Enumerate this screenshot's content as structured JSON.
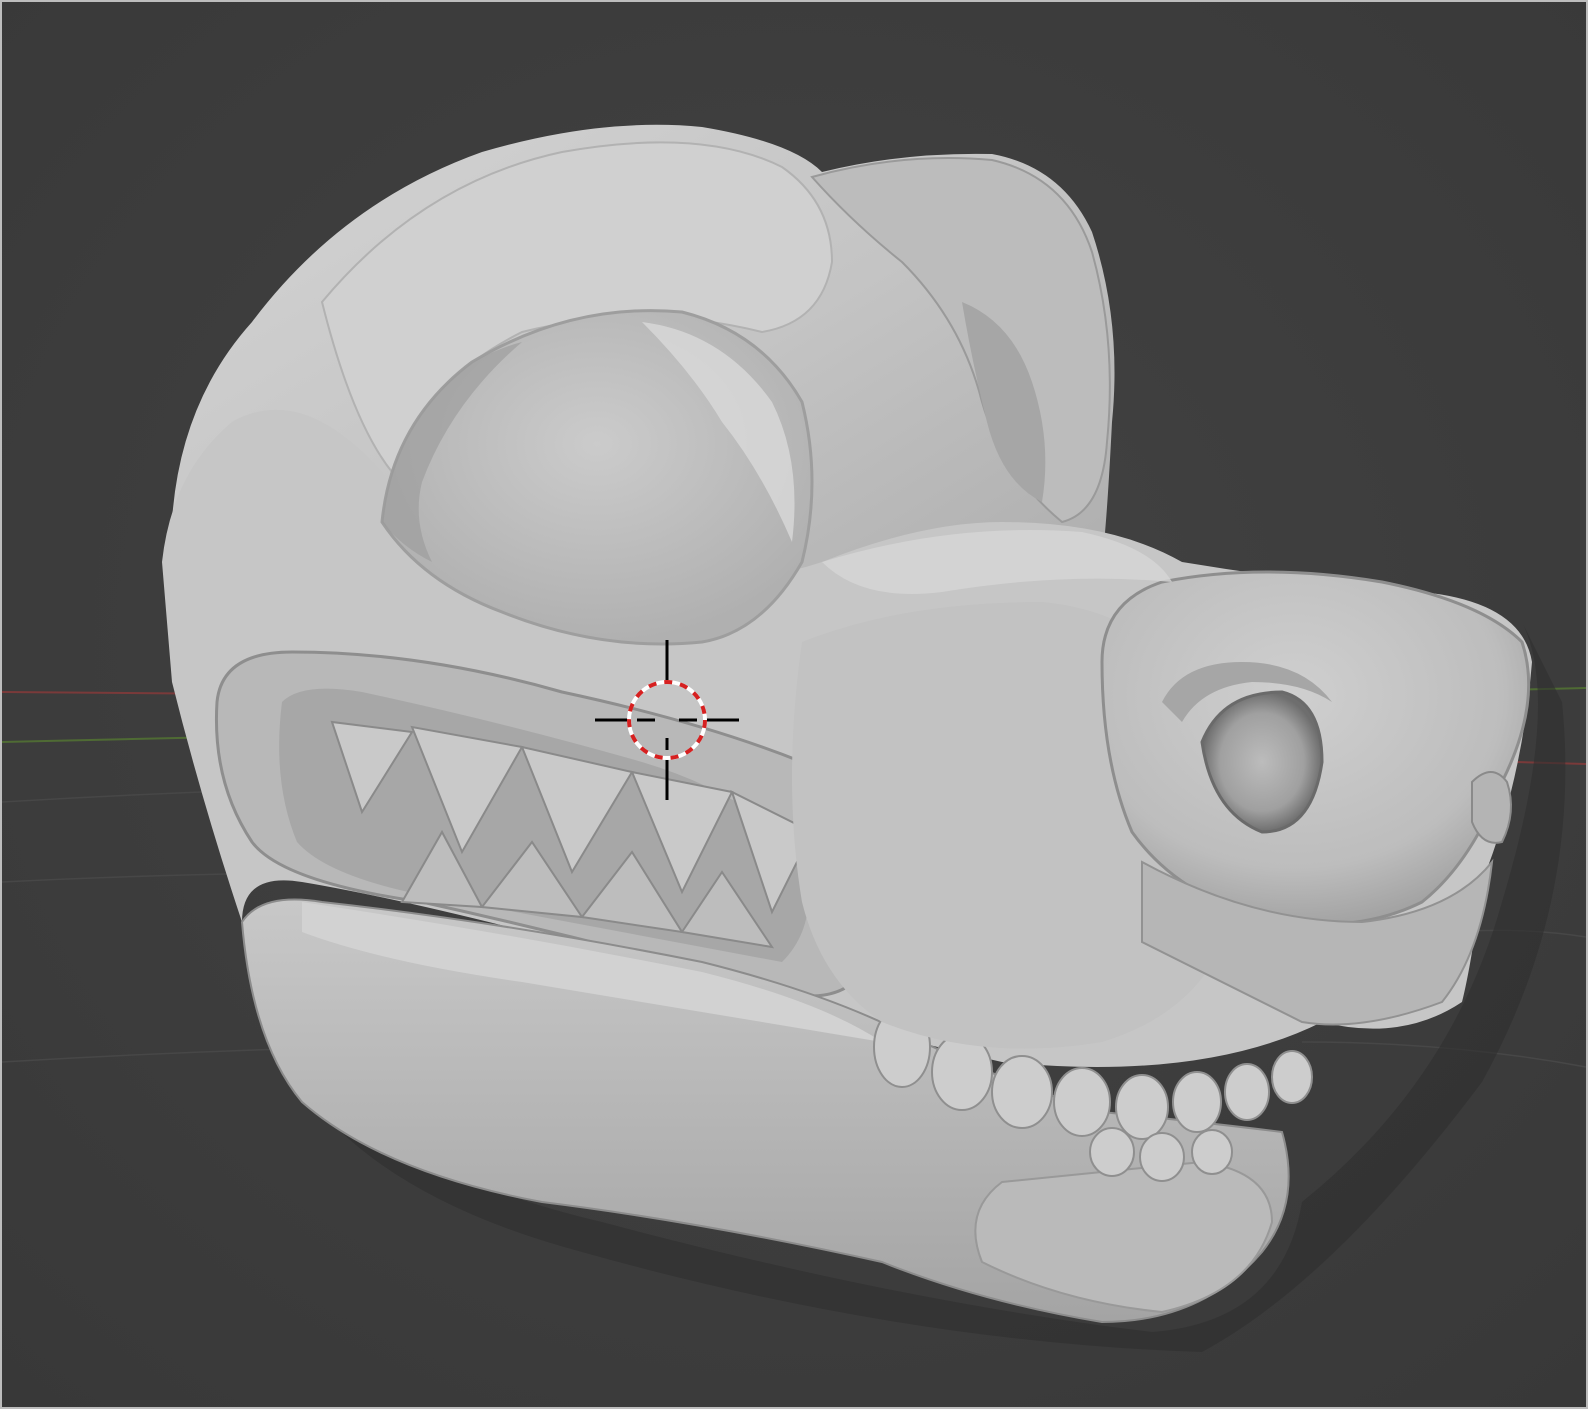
{
  "app": "Blender",
  "viewport": {
    "mode": "sculpt",
    "background_color": "#3d3d3d",
    "grid_floor": true,
    "axis_x_color": "#8a3a3a",
    "axis_y_color": "#5b7a3a",
    "grid_line_color": "#4a4a4a"
  },
  "model": {
    "subject": "creature-head-mask",
    "base_color": "#c8c8c8",
    "shadow_color": "#7a7a7a",
    "highlight_color": "#e6e6e6"
  },
  "cursor": {
    "icon": "3d-cursor-icon",
    "ring_color_a": "#d62020",
    "ring_color_b": "#ffffff",
    "cross_color": "#000000"
  }
}
